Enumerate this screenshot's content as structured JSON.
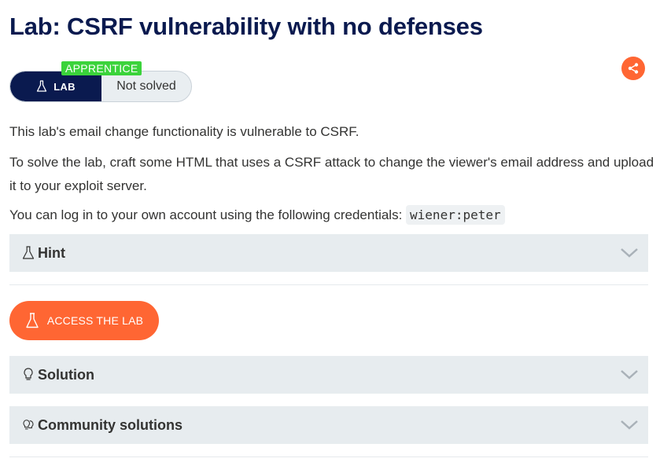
{
  "page": {
    "title": "Lab: CSRF vulnerability with no defenses"
  },
  "status": {
    "level": "APPRENTICE",
    "lab_label": "LAB",
    "solved_status": "Not solved"
  },
  "share": {
    "icon": "share-icon"
  },
  "description": {
    "p1": "This lab's email change functionality is vulnerable to CSRF.",
    "p2": "To solve the lab, craft some HTML that uses a CSRF attack to change the viewer's email address and upload it to your exploit server.",
    "p3_text": "You can log in to your own account using the following credentials: ",
    "p3_code": "wiener:peter"
  },
  "hint": {
    "label": "Hint",
    "icon": "flask-icon"
  },
  "access_button": {
    "label": "ACCESS THE LAB",
    "icon": "flask-icon"
  },
  "solution": {
    "label": "Solution",
    "icon": "lightbulb-icon"
  },
  "community": {
    "label": "Community solutions",
    "icon": "lightbulbs-icon"
  },
  "colors": {
    "navy": "#0a1a4f",
    "orange": "#ff6633",
    "green": "#3bd33b",
    "accordion_bg": "#e7ecef"
  }
}
